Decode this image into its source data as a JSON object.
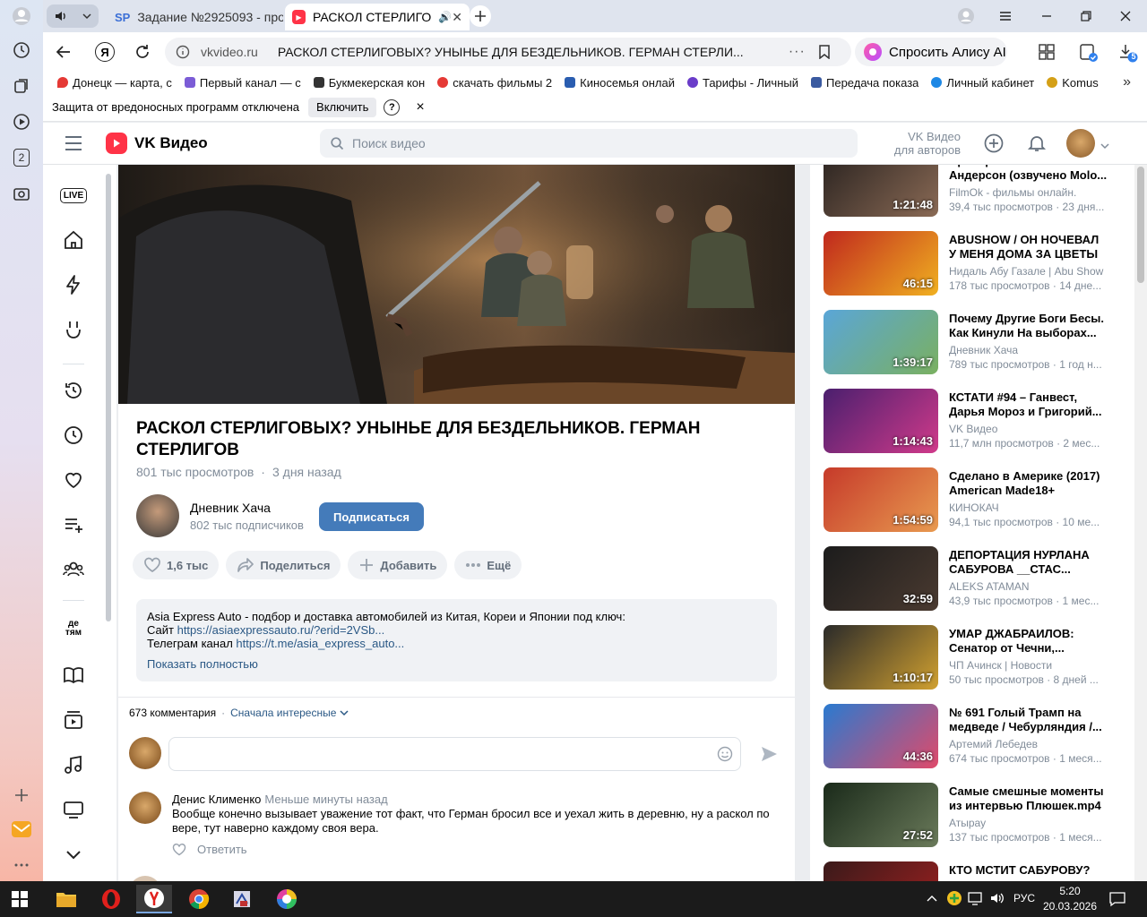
{
  "browser": {
    "tabs": [
      {
        "icon": "SP",
        "title": "Задание №2925093 - про"
      },
      {
        "icon": "vk",
        "title": "РАСКОЛ СТЕРЛИГО"
      }
    ],
    "url": "vkvideo.ru",
    "page_title": "РАСКОЛ СТЕРЛИГОВЫХ? УНЫНЬЕ ДЛЯ БЕЗДЕЛЬНИКОВ. ГЕРМАН СТЕРЛИ...",
    "alice": "Спросить Алису AI",
    "downloads_badge": "5",
    "left_badge": "2",
    "bookmarks": [
      {
        "label": "Донецк — карта, с",
        "color": "#e53935"
      },
      {
        "label": "Первый канал — с",
        "color": "#7b5cd6"
      },
      {
        "label": "Букмекерская кон",
        "color": "#333333"
      },
      {
        "label": "скачать фильмы 2",
        "color": "#e53935"
      },
      {
        "label": "Киносемья онлай",
        "color": "#2a5db0"
      },
      {
        "label": "Тарифы - Личный",
        "color": "#6a3cc9"
      },
      {
        "label": "Передача показа",
        "color": "#3a5aa0"
      },
      {
        "label": "Личный кабинет",
        "color": "#1e88e5"
      },
      {
        "label": "Komus",
        "color": "#d4a017"
      }
    ],
    "warning": {
      "text": "Защита от вредоносных программ отключена",
      "button": "Включить",
      "help": "?",
      "close": "×"
    }
  },
  "vk": {
    "logo": "VK Видео",
    "search_placeholder": "Поиск видео",
    "authors_line1": "VK Видео",
    "authors_line2": "для авторов",
    "nav_live": "LIVE",
    "nav_kids": "де тям"
  },
  "video": {
    "title": "РАСКОЛ СТЕРЛИГОВЫХ? УНЫНЬЕ ДЛЯ БЕЗДЕЛЬНИКОВ. ГЕРМАН СТЕРЛИГОВ",
    "views": "801 тыс просмотров",
    "age": "3 дня назад",
    "channel": "Дневник Хача",
    "subscribers": "802 тыс подписчиков",
    "subscribe": "Подписаться",
    "likes": "1,6 тыс",
    "share": "Поделиться",
    "add": "Добавить",
    "more": "Ещё",
    "desc_line1": "Asia Express Auto - подбор и доставка автомобилей из Китая, Кореи и Японии под ключ:",
    "desc_site_label": "Сайт ",
    "desc_site_link": "https://asiaexpressauto.ru/?erid=2VSb...",
    "desc_tg_label": "Телеграм канал ",
    "desc_tg_link": "https://t.me/asia_express_auto...",
    "show_more": "Показать полностью"
  },
  "comments": {
    "count": "673 комментария",
    "sort": "Сначала интересные",
    "items": [
      {
        "author": "Денис Клименко",
        "time": "Меньше минуты назад",
        "text": "Вообще конечно вызывает уважение тот факт, что Герман бросил все и уехал жить в деревню, ну а раскол по вере, тут наверно каждому своя вера.",
        "reply": "Ответить"
      }
    ]
  },
  "recommended": [
    {
      "title": "Проверка Памела Андерсон (озвучено Molo...",
      "author": "FilmOk - фильмы онлайн.",
      "meta": "39,4 тыс просмотров · 23 дня...",
      "duration": "1:21:48",
      "c1": "#2a2320",
      "c2": "#8a6a55"
    },
    {
      "title": "ABUSHOW / ОН НОЧЕВАЛ У МЕНЯ ДОМА ЗА ЦВЕТЫ",
      "author": "Нидаль Абу Газале | Abu Show",
      "meta": "178 тыс просмотров · 14 дне...",
      "duration": "46:15",
      "c1": "#c0281e",
      "c2": "#f0b020"
    },
    {
      "title": "Почему Другие Боги Бесы. Как Кинули На выборах...",
      "author": "Дневник Хача",
      "meta": "789 тыс просмотров · 1 год н...",
      "duration": "1:39:17",
      "c1": "#5aa6d8",
      "c2": "#7ab060"
    },
    {
      "title": "КСТАТИ #94 – Ганвест, Дарья Мороз и Григорий...",
      "author": "VK Видео",
      "meta": "11,7 млн просмотров · 2 мес...",
      "duration": "1:14:43",
      "c1": "#4a1f6e",
      "c2": "#d03a8a"
    },
    {
      "title": "Сделано в Америке (2017) American Made18+",
      "author": "КИНОКАЧ",
      "meta": "94,1 тыс просмотров · 10 ме...",
      "duration": "1:54:59",
      "c1": "#c63a2a",
      "c2": "#e89a50"
    },
    {
      "title": "ДЕПОРТАЦИЯ НУРЛАНА САБУРОВА __СТАС...",
      "author": "ALEKS ATAMAN",
      "meta": "43,9 тыс просмотров · 1 мес...",
      "duration": "32:59",
      "c1": "#1c1c1c",
      "c2": "#4a3a30"
    },
    {
      "title": "УМАР ДЖАБРАИЛОВ: Сенатор от Чечни,...",
      "author": "ЧП Ачинск | Новости",
      "meta": "50 тыс просмотров · 8 дней ...",
      "duration": "1:10:17",
      "c1": "#2a2a2a",
      "c2": "#d0a030"
    },
    {
      "title": "№ 691 Голый Трамп на медведе / Чебурляндия /...",
      "author": "Артемий Лебедев",
      "meta": "674 тыс просмотров · 1 меся...",
      "duration": "44:36",
      "c1": "#2a7ad0",
      "c2": "#e04a6a"
    },
    {
      "title": "Самые смешные моменты из интервью Плюшек.mp4",
      "author": "Атырау",
      "meta": "137 тыс просмотров · 1 меся...",
      "duration": "27:52",
      "c1": "#1a2a1a",
      "c2": "#6a7a5a"
    },
    {
      "title": "КТО МСТИТ САБУРОВУ?",
      "author": "",
      "meta": "",
      "duration": "",
      "c1": "#3a1a1a",
      "c2": "#a02020"
    }
  ],
  "taskbar": {
    "lang": "РУС",
    "time": "5:20",
    "date": "20.03.2026"
  }
}
